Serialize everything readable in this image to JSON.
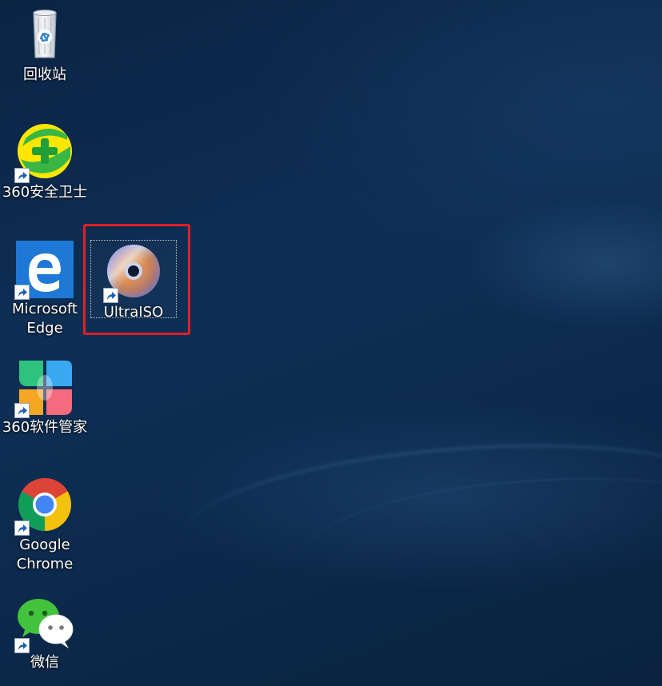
{
  "desktop": {
    "icons": [
      {
        "label": "回收站",
        "icon": "recycle-bin-icon"
      },
      {
        "label": "360安全卫士",
        "icon": "360-safe-icon"
      },
      {
        "label": "Microsoft Edge",
        "icon": "edge-icon"
      },
      {
        "label": "UltraISO",
        "icon": "ultraiso-disc-icon"
      },
      {
        "label": "360软件管家",
        "icon": "360-software-manager-icon"
      },
      {
        "label": "Google Chrome",
        "icon": "chrome-icon"
      },
      {
        "label": "微信",
        "icon": "wechat-icon"
      }
    ],
    "highlight_color": "#e02024"
  }
}
